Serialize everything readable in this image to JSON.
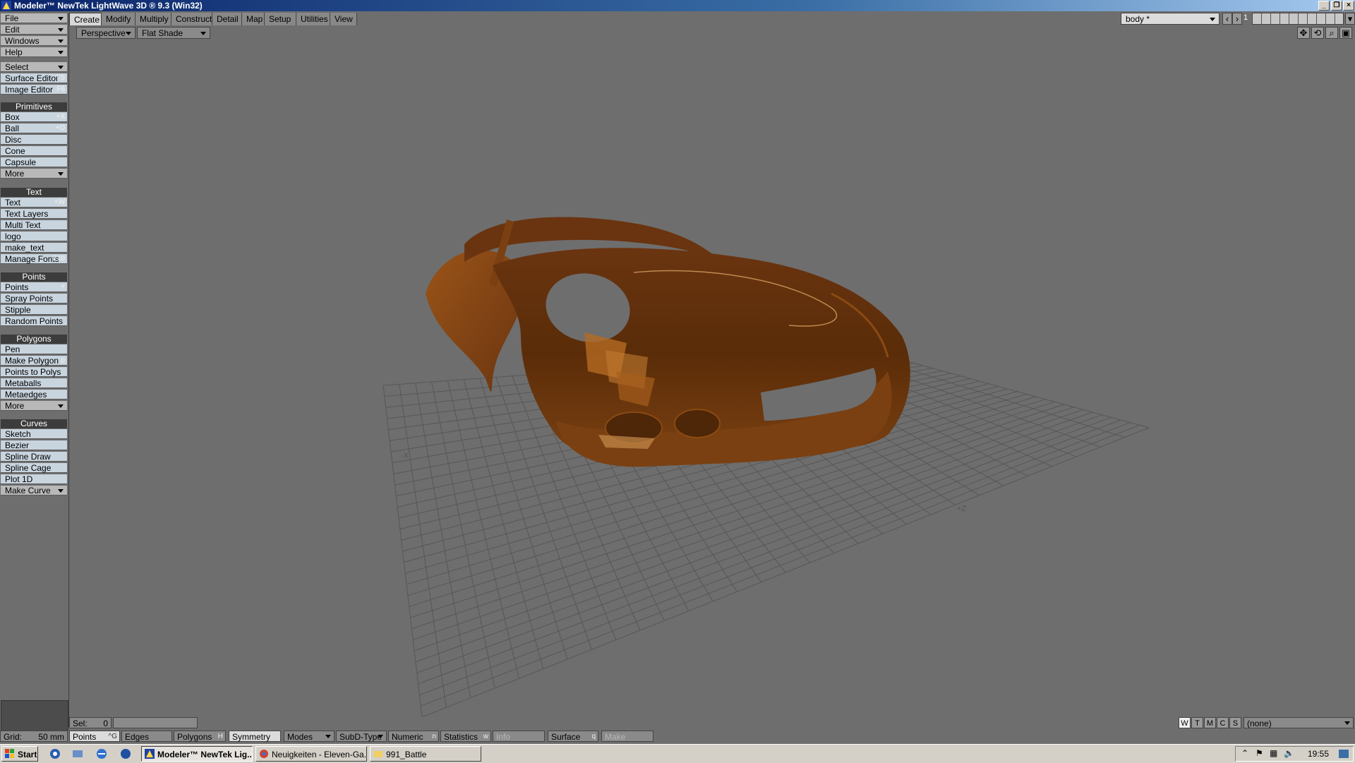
{
  "window": {
    "title": "Modeler™ NewTek LightWave 3D ® 9.3 (Win32)"
  },
  "tabs": [
    "Create",
    "Modify",
    "Multiply",
    "Construct",
    "Detail",
    "Map",
    "Setup",
    "Utilities",
    "View"
  ],
  "layer_selector": {
    "value": "body *",
    "layer_number": "1"
  },
  "sidebar": {
    "menus": [
      "File",
      "Edit",
      "Windows",
      "Help"
    ],
    "select": "Select",
    "surface_editor": {
      "label": "Surface Editor",
      "shortcut": "F5"
    },
    "image_editor": {
      "label": "Image Editor",
      "shortcut": "F6"
    },
    "groups": [
      {
        "title": "Primitives",
        "items": [
          {
            "label": "Box",
            "shortcut": "+X"
          },
          {
            "label": "Ball",
            "shortcut": "+O"
          },
          {
            "label": "Disc",
            "shortcut": ""
          },
          {
            "label": "Cone",
            "shortcut": ""
          },
          {
            "label": "Capsule",
            "shortcut": ""
          },
          {
            "label": "More",
            "shortcut": ""
          }
        ]
      },
      {
        "title": "Text",
        "items": [
          {
            "label": "Text",
            "shortcut": "+W"
          },
          {
            "label": "Text Layers",
            "shortcut": ""
          },
          {
            "label": "Multi Text",
            "shortcut": ""
          },
          {
            "label": "logo",
            "shortcut": ""
          },
          {
            "label": "make_text",
            "shortcut": ""
          },
          {
            "label": "Manage Fonts",
            "shortcut": "F10"
          }
        ]
      },
      {
        "title": "Points",
        "items": [
          {
            "label": "Points",
            "shortcut": "+"
          },
          {
            "label": "Spray Points",
            "shortcut": ""
          },
          {
            "label": "Stipple",
            "shortcut": ""
          },
          {
            "label": "Random Points",
            "shortcut": ""
          }
        ]
      },
      {
        "title": "Polygons",
        "items": [
          {
            "label": "Pen",
            "shortcut": ""
          },
          {
            "label": "Make Polygon",
            "shortcut": "p"
          },
          {
            "label": "Points to Polys",
            "shortcut": ""
          },
          {
            "label": "Metaballs",
            "shortcut": ""
          },
          {
            "label": "Metaedges",
            "shortcut": ""
          },
          {
            "label": "More",
            "shortcut": ""
          }
        ]
      },
      {
        "title": "Curves",
        "items": [
          {
            "label": "Sketch",
            "shortcut": ""
          },
          {
            "label": "Bezier",
            "shortcut": ""
          },
          {
            "label": "Spline Draw",
            "shortcut": ""
          },
          {
            "label": "Spline Cage",
            "shortcut": ""
          },
          {
            "label": "Plot 1D",
            "shortcut": ""
          },
          {
            "label": "Make Curve",
            "shortcut": ""
          }
        ]
      }
    ]
  },
  "viewport": {
    "view": "Perspective",
    "shading": "Flat Shade",
    "axis_labels": [
      "-X",
      "+Z"
    ]
  },
  "status": {
    "sel_label": "Sel:",
    "sel_value": "0",
    "grid_label": "Grid:",
    "grid_value": "50 mm",
    "wtmcs": [
      "W",
      "T",
      "M",
      "C",
      "S"
    ],
    "surface_select": "(none)",
    "buttons": [
      {
        "label": "Points",
        "shortcut": "^G"
      },
      {
        "label": "Edges",
        "shortcut": ""
      },
      {
        "label": "Polygons",
        "shortcut": "H"
      },
      {
        "label": "Symmetry +Y",
        "shortcut": ""
      },
      {
        "label": "Modes",
        "shortcut": ""
      },
      {
        "label": "SubD-Type",
        "shortcut": ""
      },
      {
        "label": "Numeric",
        "shortcut": "n"
      },
      {
        "label": "Statistics",
        "shortcut": "w"
      },
      {
        "label": "Info",
        "shortcut": ""
      },
      {
        "label": "Surface",
        "shortcut": "q"
      },
      {
        "label": "Make",
        "shortcut": ""
      }
    ]
  },
  "taskbar": {
    "start": "Start",
    "tasks": [
      "Modeler™ NewTek Lig...",
      "Neuigkeiten - Eleven-Ga...",
      "991_Battle"
    ],
    "clock": "19:55"
  },
  "colors": {
    "body_dark": "#5a2c08",
    "body_mid": "#8a4a12",
    "body_light": "#b46a22",
    "viewport_bg": "#6e6e6e"
  }
}
